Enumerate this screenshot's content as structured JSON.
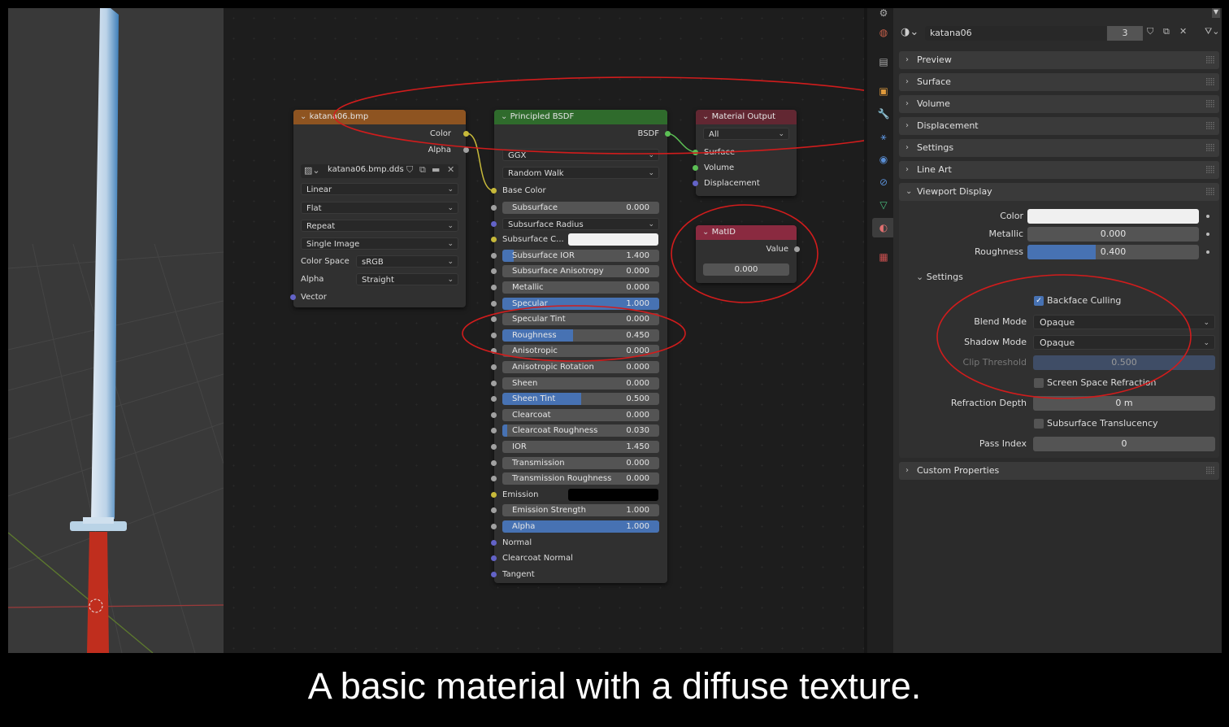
{
  "colors": {
    "texture_header": "#8e5421",
    "bsdf_header": "#2f6b2c",
    "output_header": "#622732",
    "value_header": "#8a2a40",
    "accent": "#4772b3",
    "annotation": "#d11c1c"
  },
  "caption": "A basic material with a diffuse texture.",
  "image_node": {
    "title": "katana06.bmp",
    "out_color": "Color",
    "out_alpha": "Alpha",
    "image_name": "katana06.bmp.dds",
    "interpolation": "Linear",
    "projection": "Flat",
    "extension": "Repeat",
    "source": "Single Image",
    "color_space_label": "Color Space",
    "color_space": "sRGB",
    "alpha_label": "Alpha",
    "alpha_mode": "Straight",
    "in_vector": "Vector",
    "icons": [
      "image-icon",
      "shield-icon",
      "duplicate-icon",
      "folder-icon",
      "close-icon"
    ]
  },
  "bsdf_node": {
    "title": "Principled BSDF",
    "out_bsdf": "BSDF",
    "distribution": "GGX",
    "subsurface_method": "Random Walk",
    "base_color": "Base Color",
    "inputs": [
      {
        "label": "Subsurface",
        "value": "0.000",
        "fill": 0
      },
      {
        "label": "Subsurface Radius",
        "type": "drop"
      },
      {
        "label": "Subsurface C...",
        "type": "color",
        "color": "#f2f2f2"
      },
      {
        "label": "Subsurface IOR",
        "value": "1.400",
        "fill": 0.07
      },
      {
        "label": "Subsurface Anisotropy",
        "value": "0.000",
        "fill": 0
      },
      {
        "label": "Metallic",
        "value": "0.000",
        "fill": 0
      },
      {
        "label": "Specular",
        "value": "1.000",
        "fill": 1
      },
      {
        "label": "Specular Tint",
        "value": "0.000",
        "fill": 0
      },
      {
        "label": "Roughness",
        "value": "0.450",
        "fill": 0.45
      },
      {
        "label": "Anisotropic",
        "value": "0.000",
        "fill": 0
      },
      {
        "label": "Anisotropic Rotation",
        "value": "0.000",
        "fill": 0
      },
      {
        "label": "Sheen",
        "value": "0.000",
        "fill": 0
      },
      {
        "label": "Sheen Tint",
        "value": "0.500",
        "fill": 0.5
      },
      {
        "label": "Clearcoat",
        "value": "0.000",
        "fill": 0
      },
      {
        "label": "Clearcoat Roughness",
        "value": "0.030",
        "fill": 0.03
      },
      {
        "label": "IOR",
        "value": "1.450",
        "fill": 0
      },
      {
        "label": "Transmission",
        "value": "0.000",
        "fill": 0
      },
      {
        "label": "Transmission Roughness",
        "value": "0.000",
        "fill": 0
      },
      {
        "label": "Emission",
        "type": "color",
        "color": "#000000"
      },
      {
        "label": "Emission Strength",
        "value": "1.000",
        "fill": 0
      },
      {
        "label": "Alpha",
        "value": "1.000",
        "fill": 1
      },
      {
        "label": "Normal",
        "type": "socket"
      },
      {
        "label": "Clearcoat Normal",
        "type": "socket"
      },
      {
        "label": "Tangent",
        "type": "socket"
      }
    ]
  },
  "output_node": {
    "title": "Material Output",
    "target": "All",
    "in_surface": "Surface",
    "in_volume": "Volume",
    "in_displacement": "Displacement"
  },
  "value_node": {
    "title": "MatID",
    "out_value": "Value",
    "value": "0.000"
  },
  "props": {
    "material_name": "katana06",
    "users": "3",
    "panels": [
      "Preview",
      "Surface",
      "Volume",
      "Displacement",
      "Settings",
      "Line Art"
    ],
    "viewport_display": "Viewport Display",
    "color_label": "Color",
    "color": "#f0f0f0",
    "metallic_label": "Metallic",
    "metallic": "0.000",
    "metallic_fill": 0,
    "roughness_label": "Roughness",
    "roughness": "0.400",
    "roughness_fill": 0.4,
    "settings_label": "Settings",
    "backface": "Backface Culling",
    "blend_label": "Blend Mode",
    "blend": "Opaque",
    "shadow_label": "Shadow Mode",
    "shadow": "Opaque",
    "clip_label": "Clip Threshold",
    "clip": "0.500",
    "ssr": "Screen Space Refraction",
    "refr_label": "Refraction Depth",
    "refr": "0 m",
    "sst": "Subsurface Translucency",
    "pass_label": "Pass Index",
    "pass": "0",
    "custom": "Custom Properties"
  }
}
